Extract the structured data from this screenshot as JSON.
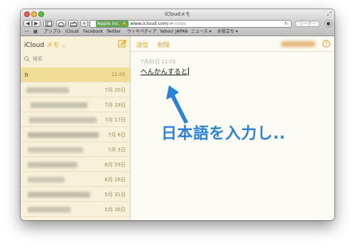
{
  "window": {
    "title": "iCloudメモ"
  },
  "toolbar": {
    "back_label": "◀",
    "forward_label": "▶",
    "add_label": "+",
    "url_brand": "Apple Inc.",
    "url_host": "www.icloud.com",
    "url_path": "/#notes",
    "reader_label": "リーダー"
  },
  "bookmarks": [
    "アップル",
    "iCloud",
    "Facebook",
    "Twitter",
    "ウィキペディア",
    "Yahoo! JAPAN",
    "ニュース ▾",
    "お役立ち ▾"
  ],
  "sidebar": {
    "title_prefix": "iCloud",
    "title_accent": "メモ",
    "search_placeholder": "検索",
    "notes": [
      {
        "title": "h",
        "date": "11:01"
      },
      {
        "title": "",
        "date": "7月 20日"
      },
      {
        "title": "",
        "date": "7月 19日"
      },
      {
        "title": "",
        "date": "7月 17日"
      },
      {
        "title": "",
        "date": "7月 6日"
      },
      {
        "title": "",
        "date": "7月 3日"
      },
      {
        "title": "",
        "date": "6月 29日"
      },
      {
        "title": "",
        "date": "6月 28日"
      },
      {
        "title": "",
        "date": "5月 31日"
      },
      {
        "title": "",
        "date": "5月 26日"
      }
    ]
  },
  "editor": {
    "send_label": "送信",
    "delete_label": "削除",
    "note_date": "7月31日 11:01",
    "note_text": "へんかんすると"
  },
  "annotation": {
    "text": "日本語を入力し..",
    "color": "#2b82d9"
  }
}
